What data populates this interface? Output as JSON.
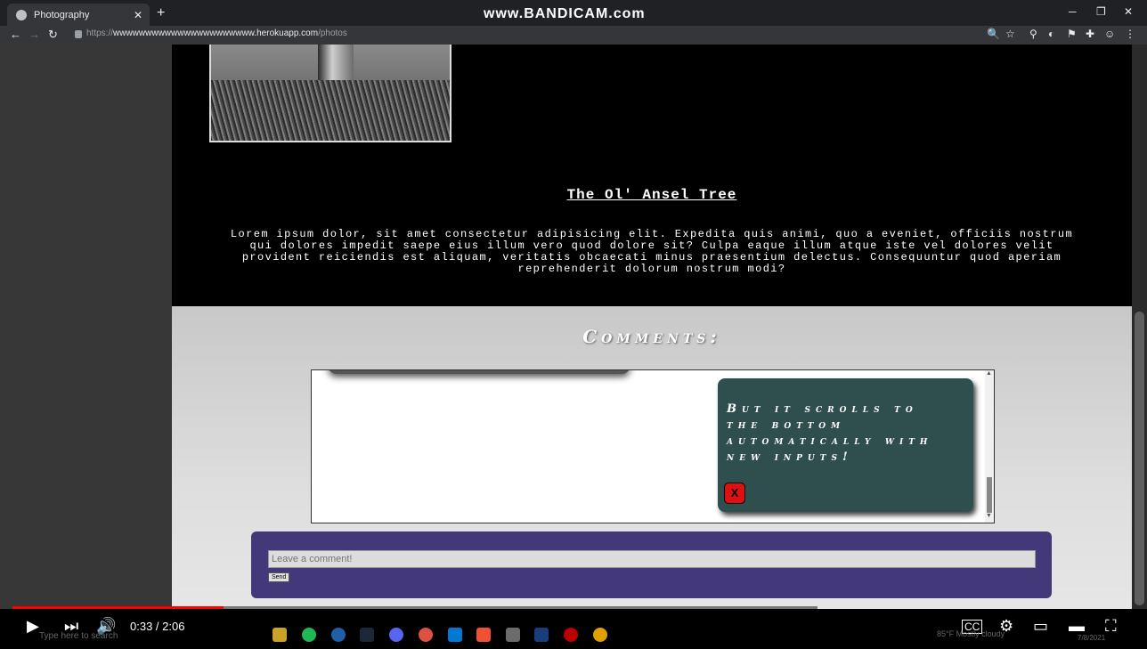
{
  "browser": {
    "tab_title": "Photography",
    "tab_close": "✕",
    "new_tab": "+",
    "watermark": "www.BANDICAM.com",
    "url_prefix": "https://",
    "url_host": "wwwwwwwwwwwwwwwwwwwwww.herokuapp.com",
    "url_path": "/photos",
    "back": "←",
    "forward": "→",
    "reload": "↻",
    "win_minimize": "─",
    "win_maximize": "❐",
    "win_close": "✕",
    "extensions": [
      "🔍",
      "☆",
      "⚲",
      "◐",
      "⚑",
      "✚",
      "☺",
      "⋮"
    ]
  },
  "photo": {
    "title": "The Ol' Ansel Tree",
    "description": "Lorem ipsum dolor, sit amet consectetur adipisicing elit. Expedita quis animi, quo a eveniet, officiis nostrum qui dolores impedit saepe eius illum vero quod dolore sit? Culpa eaque illum atque iste vel dolores velit provident reiciendis est aliquam, veritatis obcaecati minus praesentium delectus. Consequuntur quod aperiam reprehenderit dolorum nostrum modi?"
  },
  "comments": {
    "heading": "Comments:",
    "items": [
      {
        "text": "But it scrolls to the bottom automatically with new inputs!",
        "delete_label": "X"
      }
    ],
    "scroll_up": "▲",
    "scroll_down": "▼"
  },
  "form": {
    "placeholder": "Leave a comment!",
    "send_label": "Send"
  },
  "video": {
    "time": "0:33 / 2:06",
    "progress_fraction": 0.262,
    "play": "▶",
    "next": "⏭",
    "volume": "🔊",
    "cc": "CC",
    "settings": "⚙",
    "miniplayer": "▭",
    "theater": "▬",
    "fullscreen": "⛶"
  },
  "taskbar": {
    "search_placeholder": "Type here to search",
    "weather": "85°F  Mostly cloudy",
    "date": "7/8/2021"
  },
  "colors": {
    "accent_red": "#ff0000",
    "comment_card": "#2f4f4f",
    "form_panel": "#43387a"
  }
}
